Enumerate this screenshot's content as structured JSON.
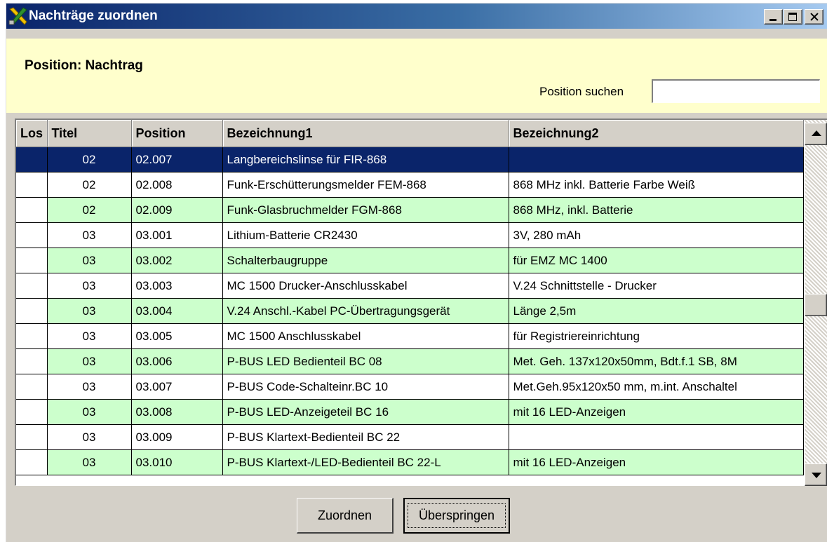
{
  "window": {
    "title": "Nachträge zuordnen",
    "icon": "app-tools-icon",
    "controls": {
      "minimize": "minimize-icon",
      "maximize": "maximize-icon",
      "close": "close-icon"
    }
  },
  "header": {
    "position_label": "Position:  Nachtrag",
    "search_label": "Position suchen",
    "search_value": ""
  },
  "grid": {
    "columns": [
      "Los",
      "Titel",
      "Position",
      "Bezeichnung1",
      "Bezeichnung2"
    ],
    "rows": [
      {
        "los": "",
        "titel": "02",
        "position": "02.007",
        "bez1": "Langbereichslinse für FIR-868",
        "bez2": ""
      },
      {
        "los": "",
        "titel": "02",
        "position": "02.008",
        "bez1": "Funk-Erschütterungsmelder FEM-868",
        "bez2": "868 MHz inkl. Batterie Farbe Weiß"
      },
      {
        "los": "",
        "titel": "02",
        "position": "02.009",
        "bez1": "Funk-Glasbruchmelder FGM-868",
        "bez2": "868 MHz, inkl. Batterie"
      },
      {
        "los": "",
        "titel": "03",
        "position": "03.001",
        "bez1": "Lithium-Batterie CR2430",
        "bez2": "3V, 280 mAh"
      },
      {
        "los": "",
        "titel": "03",
        "position": "03.002",
        "bez1": "Schalterbaugruppe",
        "bez2": "für EMZ MC 1400"
      },
      {
        "los": "",
        "titel": "03",
        "position": "03.003",
        "bez1": "MC 1500 Drucker-Anschlusskabel",
        "bez2": "V.24 Schnittstelle - Drucker"
      },
      {
        "los": "",
        "titel": "03",
        "position": "03.004",
        "bez1": "V.24 Anschl.-Kabel PC-Übertragungsgerät",
        "bez2": "Länge 2,5m"
      },
      {
        "los": "",
        "titel": "03",
        "position": "03.005",
        "bez1": "MC 1500 Anschlusskabel",
        "bez2": "für Registriereinrichtung"
      },
      {
        "los": "",
        "titel": "03",
        "position": "03.006",
        "bez1": "P-BUS LED Bedienteil BC 08",
        "bez2": "Met. Geh. 137x120x50mm, Bdt.f.1 SB, 8M"
      },
      {
        "los": "",
        "titel": "03",
        "position": "03.007",
        "bez1": "P-BUS Code-Schalteinr.BC 10",
        "bez2": "Met.Geh.95x120x50 mm, m.int. Anschaltel"
      },
      {
        "los": "",
        "titel": "03",
        "position": "03.008",
        "bez1": "P-BUS LED-Anzeigeteil BC 16",
        "bez2": "mit 16 LED-Anzeigen"
      },
      {
        "los": "",
        "titel": "03",
        "position": "03.009",
        "bez1": "P-BUS Klartext-Bedienteil BC 22",
        "bez2": ""
      },
      {
        "los": "",
        "titel": "03",
        "position": "03.010",
        "bez1": "P-BUS Klartext-/LED-Bedienteil BC 22-L",
        "bez2": "mit 16 LED-Anzeigen"
      }
    ],
    "selected_row": 0
  },
  "buttons": {
    "assign_label": "Zuordnen",
    "skip_label": "Überspringen"
  },
  "colors": {
    "title_gradient_start": "#0a246a",
    "title_gradient_end": "#a6caf0",
    "header_panel": "#ffffcc",
    "row_alt": "#ccffcc",
    "row_selected": "#0a246a"
  }
}
